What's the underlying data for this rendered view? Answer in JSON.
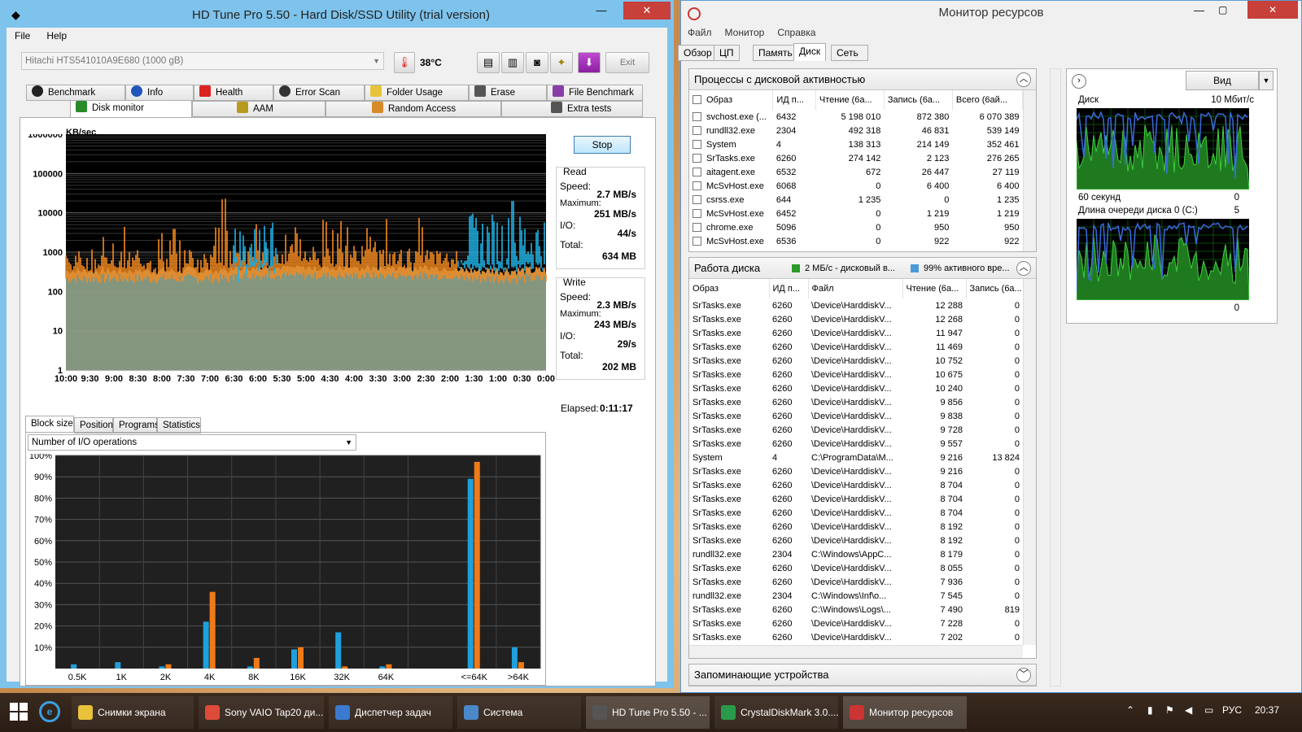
{
  "hdtune": {
    "title": "HD Tune Pro 5.50 - Hard Disk/SSD Utility (trial version)",
    "menu": [
      "File",
      "Help"
    ],
    "drive": "Hitachi HTS541010A9E680 (1000 gB)",
    "temperature": "38°C",
    "exit_label": "Exit",
    "tabs_row1": [
      "Benchmark",
      "Info",
      "Health",
      "Error Scan",
      "Folder Usage",
      "Erase",
      "File Benchmark"
    ],
    "tabs_row2": [
      "Disk monitor",
      "AAM",
      "Random Access",
      "Extra tests"
    ],
    "stop_label": "Stop",
    "yunit": "KB/sec",
    "read": {
      "header": "Read",
      "speed_label": "Speed:",
      "speed": "2.7 MB/s",
      "max_label": "Maximum:",
      "max": "251 MB/s",
      "io_label": "I/O:",
      "io": "44/s",
      "total_label": "Total:",
      "total": "634 MB"
    },
    "write": {
      "header": "Write",
      "speed_label": "Speed:",
      "speed": "2.3 MB/s",
      "max_label": "Maximum:",
      "max": "243 MB/s",
      "io_label": "I/O:",
      "io": "29/s",
      "total_label": "Total:",
      "total": "202 MB"
    },
    "elapsed_label": "Elapsed:",
    "elapsed": "0:11:17",
    "subtabs": [
      "Block size",
      "Position",
      "Programs",
      "Statistics"
    ],
    "dropdown": "Number of I/O operations"
  },
  "chart_data": [
    {
      "type": "area",
      "ylabel": "KB/sec",
      "yscale": "log",
      "yticks": [
        "1000000",
        "100000",
        "10000",
        "1000",
        "100",
        "10",
        "1"
      ],
      "xticks": [
        "10:00",
        "9:30",
        "9:00",
        "8:30",
        "8:00",
        "7:30",
        "7:00",
        "6:30",
        "6:00",
        "5:30",
        "5:00",
        "4:30",
        "4:00",
        "3:30",
        "3:00",
        "2:30",
        "2:00",
        "1:30",
        "1:00",
        "0:30",
        "0:00"
      ],
      "series": [
        {
          "name": "Read",
          "color": "#1fb4e8"
        },
        {
          "name": "Write",
          "color": "#f58a1f"
        }
      ]
    },
    {
      "type": "bar",
      "categories": [
        "0.5K",
        "1K",
        "2K",
        "4K",
        "8K",
        "16K",
        "32K",
        "64K",
        "<=64K",
        ">64K"
      ],
      "yticks": [
        "100%",
        "90%",
        "80%",
        "70%",
        "60%",
        "50%",
        "40%",
        "30%",
        "20%",
        "10%"
      ],
      "ylim": [
        0,
        100
      ],
      "series": [
        {
          "color": "#1fa0dc",
          "values": [
            2,
            3,
            1,
            22,
            1,
            9,
            17,
            1,
            89,
            10
          ]
        },
        {
          "color": "#f07a18",
          "values": [
            0,
            0,
            2,
            36,
            5,
            10,
            1,
            2,
            97,
            3
          ]
        }
      ]
    }
  ],
  "resmon": {
    "title": "Монитор ресурсов",
    "menu": [
      "Файл",
      "Монитор",
      "Справка"
    ],
    "tabs": [
      "Обзор",
      "ЦП",
      "Память",
      "Диск",
      "Сеть"
    ],
    "proc_section": "Процессы с дисковой активностью",
    "proc_cols": [
      "Образ",
      "ИД п...",
      "Чтение (6а...",
      "Запись (6а...",
      "Всего (6ай..."
    ],
    "procs": [
      [
        "svchost.exe (...",
        "6432",
        "5 198 010",
        "872 380",
        "6 070 389"
      ],
      [
        "rundll32.exe",
        "2304",
        "492 318",
        "46 831",
        "539 149"
      ],
      [
        "System",
        "4",
        "138 313",
        "214 149",
        "352 461"
      ],
      [
        "SrTasks.exe",
        "6260",
        "274 142",
        "2 123",
        "276 265"
      ],
      [
        "aitagent.exe",
        "6532",
        "672",
        "26 447",
        "27 119"
      ],
      [
        "McSvHost.exe",
        "6068",
        "0",
        "6 400",
        "6 400"
      ],
      [
        "csrss.exe",
        "644",
        "1 235",
        "0",
        "1 235"
      ],
      [
        "McSvHost.exe",
        "6452",
        "0",
        "1 219",
        "1 219"
      ],
      [
        "chrome.exe",
        "5096",
        "0",
        "950",
        "950"
      ],
      [
        "McSvHost.exe",
        "6536",
        "0",
        "922",
        "922"
      ]
    ],
    "disk_section": "Работа диска",
    "disk_legend1": "2 МБ/с - дисковый в...",
    "disk_legend2": "99% активного вре...",
    "disk_cols": [
      "Образ",
      "ИД п...",
      "Файл",
      "Чтение (6а...",
      "Запись (6а..."
    ],
    "disk_rows": [
      [
        "SrTasks.exe",
        "6260",
        "\\Device\\HarddiskV...",
        "12 288",
        "0"
      ],
      [
        "SrTasks.exe",
        "6260",
        "\\Device\\HarddiskV...",
        "12 268",
        "0"
      ],
      [
        "SrTasks.exe",
        "6260",
        "\\Device\\HarddiskV...",
        "11 947",
        "0"
      ],
      [
        "SrTasks.exe",
        "6260",
        "\\Device\\HarddiskV...",
        "11 469",
        "0"
      ],
      [
        "SrTasks.exe",
        "6260",
        "\\Device\\HarddiskV...",
        "10 752",
        "0"
      ],
      [
        "SrTasks.exe",
        "6260",
        "\\Device\\HarddiskV...",
        "10 675",
        "0"
      ],
      [
        "SrTasks.exe",
        "6260",
        "\\Device\\HarddiskV...",
        "10 240",
        "0"
      ],
      [
        "SrTasks.exe",
        "6260",
        "\\Device\\HarddiskV...",
        "9 856",
        "0"
      ],
      [
        "SrTasks.exe",
        "6260",
        "\\Device\\HarddiskV...",
        "9 838",
        "0"
      ],
      [
        "SrTasks.exe",
        "6260",
        "\\Device\\HarddiskV...",
        "9 728",
        "0"
      ],
      [
        "SrTasks.exe",
        "6260",
        "\\Device\\HarddiskV...",
        "9 557",
        "0"
      ],
      [
        "System",
        "4",
        "C:\\ProgramData\\M...",
        "9 216",
        "13 824"
      ],
      [
        "SrTasks.exe",
        "6260",
        "\\Device\\HarddiskV...",
        "9 216",
        "0"
      ],
      [
        "SrTasks.exe",
        "6260",
        "\\Device\\HarddiskV...",
        "8 704",
        "0"
      ],
      [
        "SrTasks.exe",
        "6260",
        "\\Device\\HarddiskV...",
        "8 704",
        "0"
      ],
      [
        "SrTasks.exe",
        "6260",
        "\\Device\\HarddiskV...",
        "8 704",
        "0"
      ],
      [
        "SrTasks.exe",
        "6260",
        "\\Device\\HarddiskV...",
        "8 192",
        "0"
      ],
      [
        "SrTasks.exe",
        "6260",
        "\\Device\\HarddiskV...",
        "8 192",
        "0"
      ],
      [
        "rundll32.exe",
        "2304",
        "C:\\Windows\\AppC...",
        "8 179",
        "0"
      ],
      [
        "SrTasks.exe",
        "6260",
        "\\Device\\HarddiskV...",
        "8 055",
        "0"
      ],
      [
        "SrTasks.exe",
        "6260",
        "\\Device\\HarddiskV...",
        "7 936",
        "0"
      ],
      [
        "rundll32.exe",
        "2304",
        "C:\\Windows\\Inf\\o...",
        "7 545",
        "0"
      ],
      [
        "SrTasks.exe",
        "6260",
        "C:\\Windows\\Logs\\...",
        "7 490",
        "819"
      ],
      [
        "SrTasks.exe",
        "6260",
        "\\Device\\HarddiskV...",
        "7 228",
        "0"
      ],
      [
        "SrTasks.exe",
        "6260",
        "\\Device\\HarddiskV...",
        "7 202",
        "0"
      ]
    ],
    "storage_section": "Запоминающие устройства",
    "view_label": "Вид",
    "graph1_title": "Диск",
    "graph1_max": "10 Мбит/с",
    "graph1_xlabel": "60 секунд",
    "graph1_min": "0",
    "graph2_title": "Длина очереди диска 0 (C:)",
    "graph2_max": "5",
    "graph2_min": "0"
  },
  "taskbar": {
    "items": [
      "Снимки экрана",
      "Sony VAIO Tap20 ди...",
      "Диспетчер задач",
      "Система",
      "HD Tune Pro 5.50 - ...",
      "CrystalDiskMark 3.0....",
      "Монитор ресурсов"
    ],
    "lang": "РУС",
    "time": "20:37"
  }
}
